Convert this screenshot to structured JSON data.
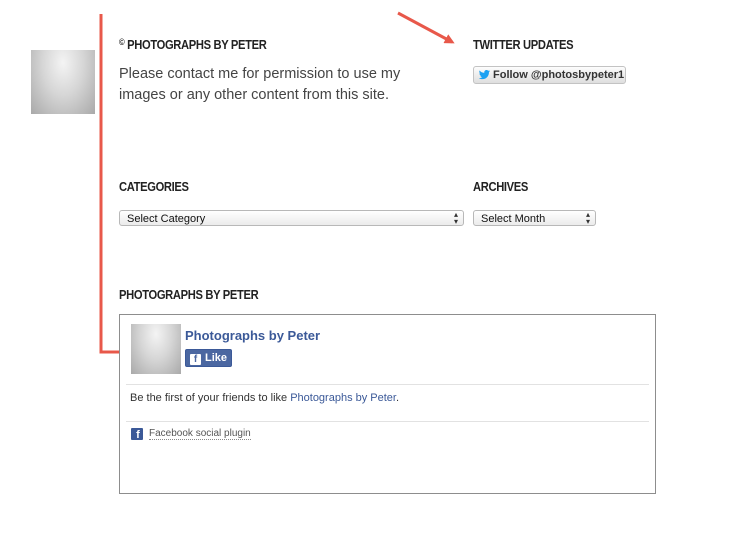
{
  "copyright": {
    "symbol": "©",
    "title": "PHOTOGRAPHS BY PETER",
    "text": "Please contact me for permission to use my images or any other content from this site."
  },
  "twitter": {
    "heading": "TWITTER UPDATES",
    "follow_button": "Follow @photosbypeter1",
    "icon": "twitter-bird-icon"
  },
  "categories": {
    "heading": "CATEGORIES",
    "selected": "Select Category"
  },
  "archives": {
    "heading": "ARCHIVES",
    "selected": "Select Month"
  },
  "facebook_widget": {
    "heading": "PHOTOGRAPHS BY PETER",
    "page_name": "Photographs by Peter",
    "like_label": "Like",
    "friends_text": "Be the first of your friends to like ",
    "friends_link": "Photographs by Peter",
    "friends_suffix": ".",
    "plugin_label": "Facebook social plugin"
  },
  "colors": {
    "annotation_arrow": "#e8584a",
    "facebook_blue": "#3b5998",
    "twitter_blue": "#1da1f2"
  }
}
